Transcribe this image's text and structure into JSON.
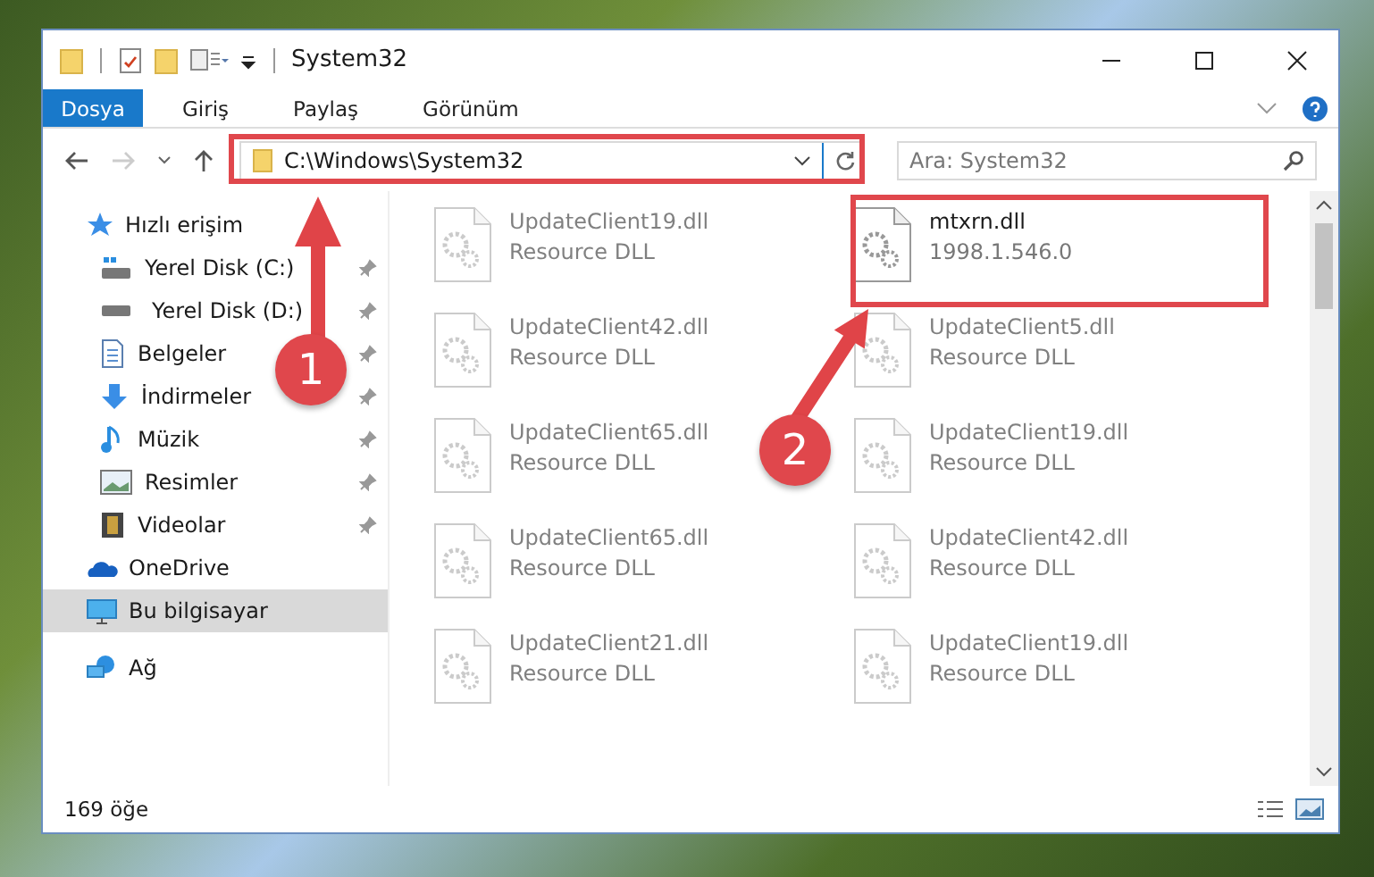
{
  "window": {
    "title": "System32"
  },
  "ribbon_tabs": [
    {
      "label": "Dosya",
      "selected": true
    },
    {
      "label": "Giriş",
      "selected": false
    },
    {
      "label": "Paylaş",
      "selected": false
    },
    {
      "label": "Görünüm",
      "selected": false
    }
  ],
  "address": {
    "value": "C:\\Windows\\System32"
  },
  "search": {
    "placeholder": "Ara: System32"
  },
  "sidebar": {
    "items": [
      {
        "label": "Hızlı erişim",
        "kind": "star",
        "selected": false,
        "children": [
          {
            "label": "Yerel Disk (C:)",
            "kind": "drive-c",
            "pinned": true
          },
          {
            "label": "Yerel Disk (D:)",
            "kind": "drive",
            "pinned": true
          },
          {
            "label": "Belgeler",
            "kind": "doc",
            "pinned": true
          },
          {
            "label": "İndirmeler",
            "kind": "download",
            "pinned": true
          },
          {
            "label": "Müzik",
            "kind": "music",
            "pinned": true
          },
          {
            "label": "Resimler",
            "kind": "pictures",
            "pinned": true
          },
          {
            "label": "Videolar",
            "kind": "video",
            "pinned": true
          }
        ]
      },
      {
        "label": "OneDrive",
        "kind": "cloud",
        "selected": false
      },
      {
        "label": "Bu bilgisayar",
        "kind": "pc",
        "selected": true
      },
      {
        "label": "Ağ",
        "kind": "network",
        "selected": false
      }
    ]
  },
  "files": [
    {
      "name": "UpdateClient19.dll",
      "detail": "Resource DLL",
      "blurred": true
    },
    {
      "name": "mtxrn.dll",
      "detail": "1998.1.546.0",
      "blurred": false
    },
    {
      "name": "UpdateClient42.dll",
      "detail": "Resource DLL",
      "blurred": true
    },
    {
      "name": "UpdateClient5.dll",
      "detail": "Resource DLL",
      "blurred": true
    },
    {
      "name": "UpdateClient65.dll",
      "detail": "Resource DLL",
      "blurred": true
    },
    {
      "name": "UpdateClient19.dll",
      "detail": "Resource DLL",
      "blurred": true
    },
    {
      "name": "UpdateClient65.dll",
      "detail": "Resource DLL",
      "blurred": true
    },
    {
      "name": "UpdateClient42.dll",
      "detail": "Resource DLL",
      "blurred": true
    },
    {
      "name": "UpdateClient21.dll",
      "detail": "Resource DLL",
      "blurred": true
    },
    {
      "name": "UpdateClient19.dll",
      "detail": "Resource DLL",
      "blurred": true
    }
  ],
  "status_bar": {
    "count": "169 öğe"
  },
  "annotations": [
    {
      "number": "1"
    },
    {
      "number": "2"
    }
  ]
}
